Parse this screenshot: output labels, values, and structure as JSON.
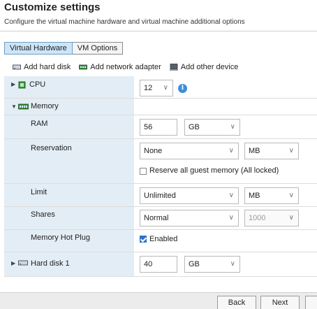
{
  "header": {
    "title": "Customize settings",
    "subtitle": "Configure the virtual machine hardware and virtual machine additional options"
  },
  "tabs": [
    {
      "label": "Virtual Hardware",
      "active": true
    },
    {
      "label": "VM Options",
      "active": false
    }
  ],
  "toolbar": {
    "add_hard_disk": "Add hard disk",
    "add_network_adapter": "Add network adapter",
    "add_other_device": "Add other device"
  },
  "cpu": {
    "label": "CPU",
    "value": "12"
  },
  "memory": {
    "label": "Memory",
    "ram_label": "RAM",
    "ram_value": "56",
    "ram_unit": "GB",
    "reservation_label": "Reservation",
    "reservation_value": "None",
    "reservation_unit": "MB",
    "reserve_all_label": "Reserve all guest memory (All locked)",
    "reserve_all_checked": false,
    "limit_label": "Limit",
    "limit_value": "Unlimited",
    "limit_unit": "MB",
    "shares_label": "Shares",
    "shares_value": "Normal",
    "shares_number": "1000",
    "hotplug_label": "Memory Hot Plug",
    "hotplug_option": "Enabled",
    "hotplug_checked": true
  },
  "hard_disk": {
    "label": "Hard disk 1",
    "value": "40",
    "unit": "GB"
  },
  "footer": {
    "back_label": "Back",
    "next_label": "Next"
  },
  "colors": {
    "accent": "#3f8fd9",
    "tab_active": "#cde5f7",
    "label_column": "#e3edf5"
  }
}
